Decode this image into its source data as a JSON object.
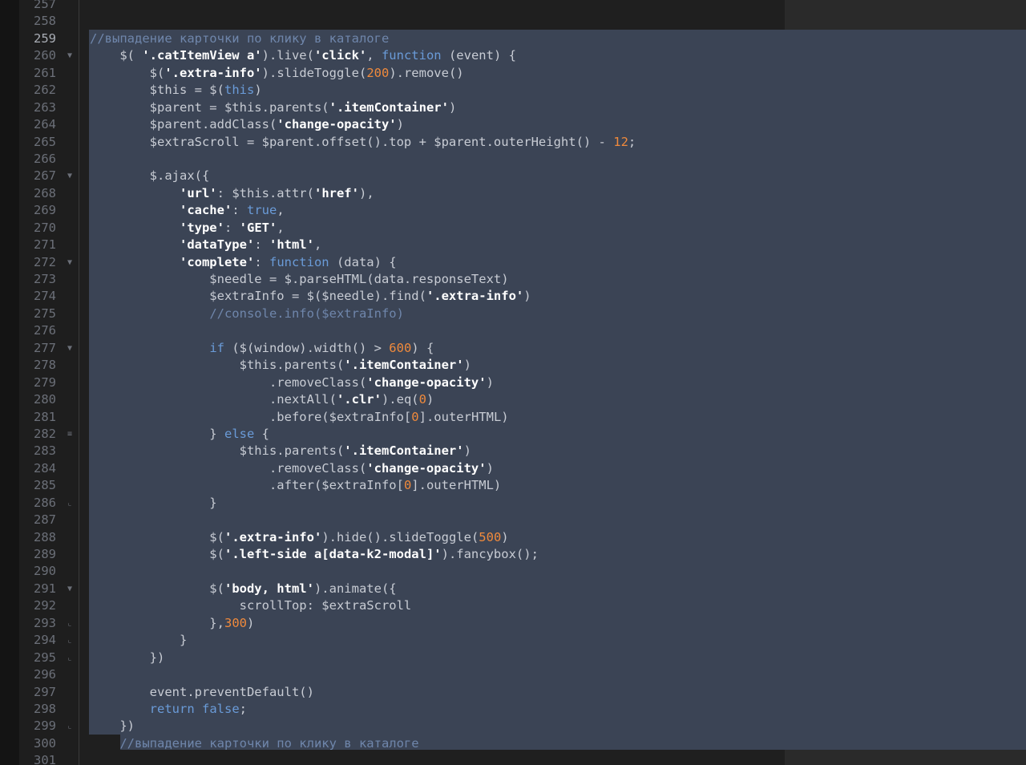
{
  "editor": {
    "lines": [
      {
        "n": "257",
        "fold": "",
        "tokens": []
      },
      {
        "n": "258",
        "fold": "",
        "tokens": []
      },
      {
        "n": "259",
        "fold": "",
        "tokens": [
          [
            "cm",
            "//выпадение карточки по клику в каталоге"
          ]
        ]
      },
      {
        "n": "260",
        "fold": "▼",
        "tokens": [
          [
            "pl",
            "    $( "
          ],
          [
            "str",
            "'.catItemView a'"
          ],
          [
            "pl",
            ").live("
          ],
          [
            "str",
            "'click'"
          ],
          [
            "pl",
            ", "
          ],
          [
            "kw",
            "function"
          ],
          [
            "pl",
            " (event) {"
          ]
        ]
      },
      {
        "n": "261",
        "fold": "",
        "tokens": [
          [
            "pl",
            "        $("
          ],
          [
            "str",
            "'.extra-info'"
          ],
          [
            "pl",
            ").slideToggle("
          ],
          [
            "num",
            "200"
          ],
          [
            "pl",
            ").remove()"
          ]
        ]
      },
      {
        "n": "262",
        "fold": "",
        "tokens": [
          [
            "pl",
            "        $this = $("
          ],
          [
            "kw",
            "this"
          ],
          [
            "pl",
            ")"
          ]
        ]
      },
      {
        "n": "263",
        "fold": "",
        "tokens": [
          [
            "pl",
            "        $parent = $this.parents("
          ],
          [
            "str",
            "'.itemContainer'"
          ],
          [
            "pl",
            ")"
          ]
        ]
      },
      {
        "n": "264",
        "fold": "",
        "tokens": [
          [
            "pl",
            "        $parent.addClass("
          ],
          [
            "str",
            "'change-opacity'"
          ],
          [
            "pl",
            ")"
          ]
        ]
      },
      {
        "n": "265",
        "fold": "",
        "tokens": [
          [
            "pl",
            "        $extraScroll = $parent.offset().top + $parent.outerHeight() - "
          ],
          [
            "num",
            "12"
          ],
          [
            "pl",
            ";"
          ]
        ]
      },
      {
        "n": "266",
        "fold": "",
        "tokens": []
      },
      {
        "n": "267",
        "fold": "▼",
        "tokens": [
          [
            "pl",
            "        $.ajax({"
          ]
        ]
      },
      {
        "n": "268",
        "fold": "",
        "tokens": [
          [
            "pl",
            "            "
          ],
          [
            "str",
            "'url'"
          ],
          [
            "pl",
            ": $this.attr("
          ],
          [
            "str",
            "'href'"
          ],
          [
            "pl",
            "),"
          ]
        ]
      },
      {
        "n": "269",
        "fold": "",
        "tokens": [
          [
            "pl",
            "            "
          ],
          [
            "str",
            "'cache'"
          ],
          [
            "pl",
            ": "
          ],
          [
            "kw",
            "true"
          ],
          [
            "pl",
            ","
          ]
        ]
      },
      {
        "n": "270",
        "fold": "",
        "tokens": [
          [
            "pl",
            "            "
          ],
          [
            "str",
            "'type'"
          ],
          [
            "pl",
            ": "
          ],
          [
            "str",
            "'GET'"
          ],
          [
            "pl",
            ","
          ]
        ]
      },
      {
        "n": "271",
        "fold": "",
        "tokens": [
          [
            "pl",
            "            "
          ],
          [
            "str",
            "'dataType'"
          ],
          [
            "pl",
            ": "
          ],
          [
            "str",
            "'html'"
          ],
          [
            "pl",
            ","
          ]
        ]
      },
      {
        "n": "272",
        "fold": "▼",
        "tokens": [
          [
            "pl",
            "            "
          ],
          [
            "str",
            "'complete'"
          ],
          [
            "pl",
            ": "
          ],
          [
            "kw",
            "function"
          ],
          [
            "pl",
            " (data) {"
          ]
        ]
      },
      {
        "n": "273",
        "fold": "",
        "tokens": [
          [
            "pl",
            "                $needle = $.parseHTML(data.responseText)"
          ]
        ]
      },
      {
        "n": "274",
        "fold": "",
        "tokens": [
          [
            "pl",
            "                $extraInfo = $($needle).find("
          ],
          [
            "str",
            "'.extra-info'"
          ],
          [
            "pl",
            ")"
          ]
        ]
      },
      {
        "n": "275",
        "fold": "",
        "tokens": [
          [
            "pl",
            "                "
          ],
          [
            "cm",
            "//console.info($extraInfo)"
          ]
        ]
      },
      {
        "n": "276",
        "fold": "",
        "tokens": []
      },
      {
        "n": "277",
        "fold": "▼",
        "tokens": [
          [
            "pl",
            "                "
          ],
          [
            "kw",
            "if"
          ],
          [
            "pl",
            " ($(window).width() > "
          ],
          [
            "num",
            "600"
          ],
          [
            "pl",
            ") {"
          ]
        ]
      },
      {
        "n": "278",
        "fold": "",
        "tokens": [
          [
            "pl",
            "                    $this.parents("
          ],
          [
            "str",
            "'.itemContainer'"
          ],
          [
            "pl",
            ")"
          ]
        ]
      },
      {
        "n": "279",
        "fold": "",
        "tokens": [
          [
            "pl",
            "                        .removeClass("
          ],
          [
            "str",
            "'change-opacity'"
          ],
          [
            "pl",
            ")"
          ]
        ]
      },
      {
        "n": "280",
        "fold": "",
        "tokens": [
          [
            "pl",
            "                        .nextAll("
          ],
          [
            "str",
            "'.clr'"
          ],
          [
            "pl",
            ").eq("
          ],
          [
            "num",
            "0"
          ],
          [
            "pl",
            ")"
          ]
        ]
      },
      {
        "n": "281",
        "fold": "",
        "tokens": [
          [
            "pl",
            "                        .before($extraInfo["
          ],
          [
            "num",
            "0"
          ],
          [
            "pl",
            "].outerHTML)"
          ]
        ]
      },
      {
        "n": "282",
        "fold": "≡",
        "tokens": [
          [
            "pl",
            "                } "
          ],
          [
            "kw",
            "else"
          ],
          [
            "pl",
            " {"
          ]
        ]
      },
      {
        "n": "283",
        "fold": "",
        "tokens": [
          [
            "pl",
            "                    $this.parents("
          ],
          [
            "str",
            "'.itemContainer'"
          ],
          [
            "pl",
            ")"
          ]
        ]
      },
      {
        "n": "284",
        "fold": "",
        "tokens": [
          [
            "pl",
            "                        .removeClass("
          ],
          [
            "str",
            "'change-opacity'"
          ],
          [
            "pl",
            ")"
          ]
        ]
      },
      {
        "n": "285",
        "fold": "",
        "tokens": [
          [
            "pl",
            "                        .after($extraInfo["
          ],
          [
            "num",
            "0"
          ],
          [
            "pl",
            "].outerHTML)"
          ]
        ]
      },
      {
        "n": "286",
        "fold": "⌞",
        "tokens": [
          [
            "pl",
            "                }"
          ]
        ]
      },
      {
        "n": "287",
        "fold": "",
        "tokens": []
      },
      {
        "n": "288",
        "fold": "",
        "tokens": [
          [
            "pl",
            "                $("
          ],
          [
            "str",
            "'.extra-info'"
          ],
          [
            "pl",
            ").hide().slideToggle("
          ],
          [
            "num",
            "500"
          ],
          [
            "pl",
            ")"
          ]
        ]
      },
      {
        "n": "289",
        "fold": "",
        "tokens": [
          [
            "pl",
            "                $("
          ],
          [
            "str",
            "'.left-side a[data-k2-modal]'"
          ],
          [
            "pl",
            ").fancybox();"
          ]
        ]
      },
      {
        "n": "290",
        "fold": "",
        "tokens": []
      },
      {
        "n": "291",
        "fold": "▼",
        "tokens": [
          [
            "pl",
            "                $("
          ],
          [
            "str",
            "'body, html'"
          ],
          [
            "pl",
            ").animate({"
          ]
        ]
      },
      {
        "n": "292",
        "fold": "",
        "tokens": [
          [
            "pl",
            "                    scrollTop: $extraScroll"
          ]
        ]
      },
      {
        "n": "293",
        "fold": "⌞",
        "tokens": [
          [
            "pl",
            "                },"
          ],
          [
            "num",
            "300"
          ],
          [
            "pl",
            ")"
          ]
        ]
      },
      {
        "n": "294",
        "fold": "⌞",
        "tokens": [
          [
            "pl",
            "            }"
          ]
        ]
      },
      {
        "n": "295",
        "fold": "⌞",
        "tokens": [
          [
            "pl",
            "        })"
          ]
        ]
      },
      {
        "n": "296",
        "fold": "",
        "tokens": []
      },
      {
        "n": "297",
        "fold": "",
        "tokens": [
          [
            "pl",
            "        event.preventDefault()"
          ]
        ]
      },
      {
        "n": "298",
        "fold": "",
        "tokens": [
          [
            "pl",
            "        "
          ],
          [
            "kw",
            "return"
          ],
          [
            "pl",
            " "
          ],
          [
            "kw",
            "false"
          ],
          [
            "pl",
            ";"
          ]
        ]
      },
      {
        "n": "299",
        "fold": "⌞",
        "tokens": [
          [
            "pl",
            "    })"
          ]
        ]
      },
      {
        "n": "300",
        "fold": "",
        "tokens": [
          [
            "pl",
            "    "
          ],
          [
            "cm",
            "//выпадение карточки по клику в каталоге"
          ]
        ]
      },
      {
        "n": "301",
        "fold": "",
        "tokens": []
      }
    ]
  },
  "colors": {
    "background": "#1f1f1f",
    "selection": "#3b4455",
    "comment": "#6f86ab",
    "string": "#ffffff",
    "keyword": "#6a9bd8",
    "number": "#f08a3c",
    "plain": "#c8ccd4",
    "line_number": "#6b6f78"
  }
}
